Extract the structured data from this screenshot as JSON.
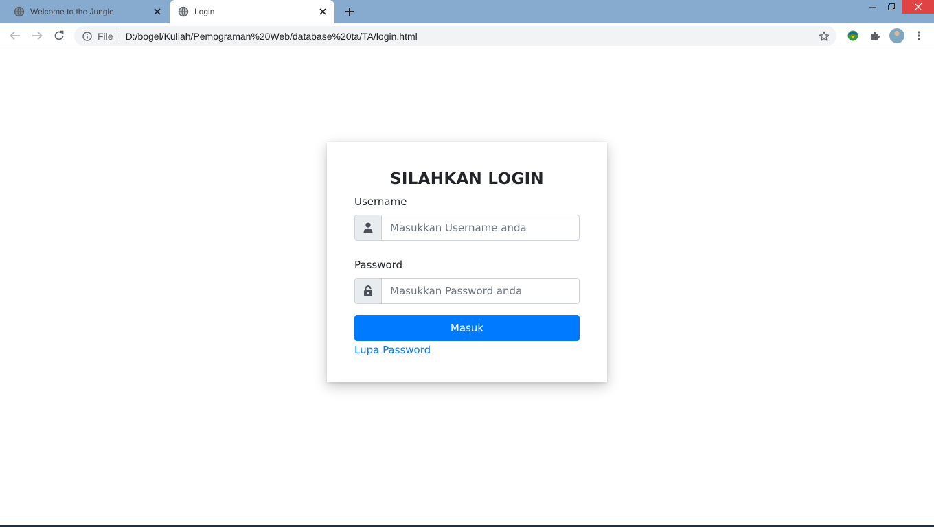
{
  "browser": {
    "tabs": [
      {
        "title": "Welcome to the Jungle",
        "active": false
      },
      {
        "title": "Login",
        "active": true
      }
    ],
    "address": {
      "scheme": "File",
      "url": "D:/bogel/Kuliah/Pemograman%20Web/database%20ta/TA/login.html"
    }
  },
  "login": {
    "heading": "SILAHKAN LOGIN",
    "username_label": "Username",
    "username_placeholder": "Masukkan Username anda",
    "password_label": "Password",
    "password_placeholder": "Masukkan Password anda",
    "submit_label": "Masuk",
    "forgot_link": "Lupa Password"
  },
  "colors": {
    "tabbar": "#87abcf",
    "primary": "#007bff",
    "close_button": "#e04343"
  },
  "icons": {
    "username": "user-icon",
    "password": "unlock-icon"
  }
}
